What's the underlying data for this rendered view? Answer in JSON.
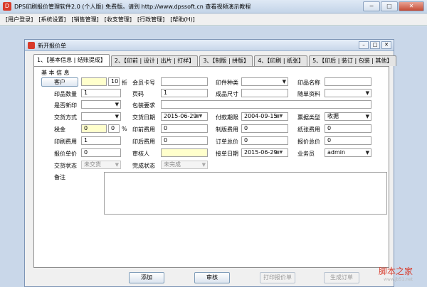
{
  "window": {
    "title": "DPS印刷报价管理软件2.0 (个人版) 免费版。请到 http://www.dpssoft.cn 查看视频演示教程",
    "icon": "app-logo-icon",
    "min": "─",
    "max": "□",
    "close": "✕"
  },
  "menu": [
    "[用户登录]",
    "[系统设置]",
    "[销售管理]",
    "[收支管理]",
    "[行政管理]",
    "[帮助(H)]"
  ],
  "child": {
    "title": "新开报价单",
    "min": "–",
    "max": "□",
    "close": "✕"
  },
  "tabs": [
    "1、【基本信息 | 结账提成】",
    "2、【印前 | 设计 | 出片 | 打样】",
    "3、【制版 | 拼版】",
    "4、【印刷 | 纸张】",
    "5、【印后 | 装订 | 包装 | 其他】"
  ],
  "form": {
    "section": "基 本 信 息",
    "customer_btn": "客户",
    "discount_value": "10",
    "discount_unit": "折",
    "member_card": "会员卡号",
    "print_type": "印件种类",
    "item_name": "印品名称",
    "qty_label": "印品数量",
    "qty_value": "1",
    "pages_label": "页码",
    "pages_value": "1",
    "size_label": "成品尺寸",
    "attach_label": "随单资料",
    "new_print_label": "是否新印",
    "pack_label": "包装要求",
    "delivery_label": "交货方式",
    "delivery_date_label": "交货日期",
    "delivery_date": "2015-06-29",
    "pay_due_label": "付款期限",
    "pay_due": "2004-09-15",
    "bill_type_label": "票据类型",
    "bill_type": "收据",
    "tax_label": "税金",
    "tax_value": "0",
    "tax_pct": "0",
    "tax_unit": "%",
    "prepress_label": "印前费用",
    "prepress_value": "0",
    "plate_label": "制版费用",
    "plate_value": "0",
    "paper_label": "纸张费用",
    "paper_value": "0",
    "print_fee_label": "印刷费用",
    "print_fee_value": "1",
    "postpress_label": "印后费用",
    "postpress_value": "0",
    "order_total_label": "订单总价",
    "order_total_value": "0",
    "quote_total_label": "报价总价",
    "quote_total_value": "0",
    "unit_price_label": "报价单价",
    "unit_price_value": "0",
    "reviewer_label": "审核人",
    "order_date_label": "接单日期",
    "order_date": "2015-06-29",
    "salesman_label": "业务员",
    "salesman_value": "admin",
    "delivery_status_label": "交货状态",
    "delivery_status": "未交货",
    "complete_status_label": "完成状态",
    "complete_status": "未完成",
    "memo_label": "备注",
    "dd": "▼",
    "cal": "▦▼"
  },
  "buttons": {
    "add": "添加",
    "review": "审核",
    "print_quote": "打印报价单",
    "gen_order": "生成订单"
  },
  "watermark": {
    "main": "脚本之家",
    "sub": "www.jb51.net"
  }
}
